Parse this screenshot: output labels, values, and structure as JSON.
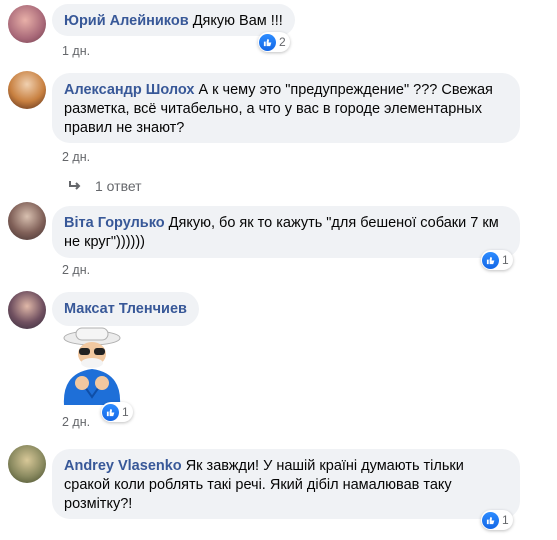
{
  "comments": [
    {
      "author": "Юрий Алейников",
      "text": "Дякую Вам !!!",
      "time": "1 дн.",
      "likes": "2"
    },
    {
      "author": "Александр Шолох",
      "text": "А к чему это \"предупреждение\" ??? Свежая разметка, всё читабельно, а что у вас в городе элементарных правил не знают?",
      "time": "2 дн.",
      "replies": "1 ответ"
    },
    {
      "author": "Віта Горулько",
      "text": "Дякую, бо як то кажуть \"для бешеної собаки 7 км не круг\"))))))",
      "time": "2 дн.",
      "likes": "1"
    },
    {
      "author": "Максат Тленчиев",
      "text": "",
      "time": "2 дн.",
      "likes": "1",
      "sticker": "old-man-sticker"
    },
    {
      "author": "Andrey Vlasenko",
      "text": "Як завжди! У нашій країні думають тільки сракой коли роблять такі речі. Який дібіл намалював таку розмітку?!",
      "time": "2 дн.",
      "likes": "1"
    }
  ],
  "colors": {
    "author": "#385898",
    "bubble": "#f0f2f5",
    "meta": "#65676b",
    "like": "#1877f2"
  }
}
